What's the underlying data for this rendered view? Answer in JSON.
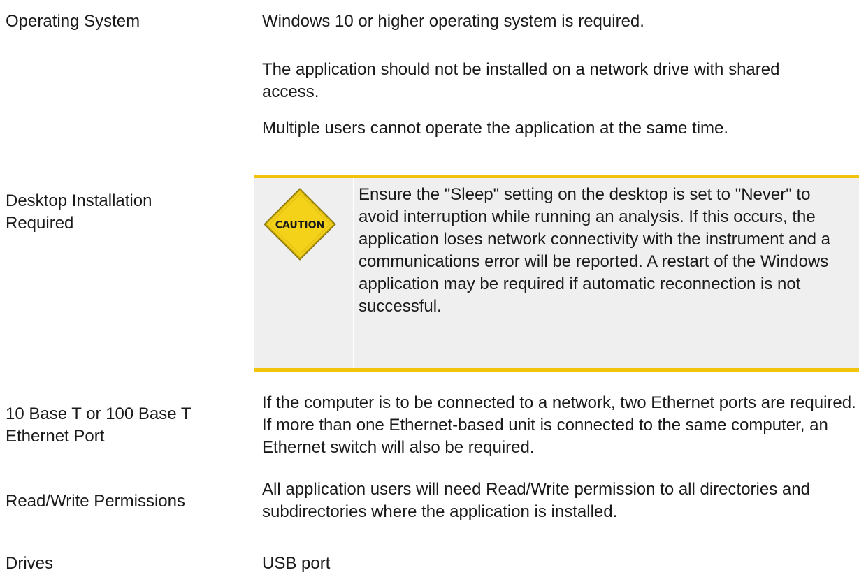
{
  "rows": [
    {
      "label": "Operating System",
      "desc": "Windows 10 or higher operating system is required."
    },
    {
      "label": "Desktop Installation Required",
      "paragraphs": [
        "The application should not be installed on a network drive with shared access.",
        "Multiple users cannot operate the application at the same time."
      ],
      "caution": {
        "icon_label": "CAUTION",
        "text": "Ensure the \"Sleep\" setting on the desktop is set to \"Never\" to avoid interruption while running an analysis. If this occurs, the application loses network connectivity with the instrument and a communications error will be reported. A restart of the Windows application may be required if automatic reconnection is not successful."
      }
    },
    {
      "label": "10 Base T or 100 Base T Ethernet Port",
      "desc": "If the computer is to be connected to a network, two Ethernet ports are required. If more than one Ethernet-based unit is connected to the same computer, an Ethernet switch will also be required."
    },
    {
      "label": "Read/Write Permissions",
      "desc": "All application users will need Read/Write permission to all directories and subdirectories where the application is installed."
    },
    {
      "label": "Drives",
      "desc": "USB port"
    }
  ],
  "colors": {
    "row_background": "#efefef",
    "caution_border": "#f1c30d",
    "caution_sign": "#f3d219"
  }
}
